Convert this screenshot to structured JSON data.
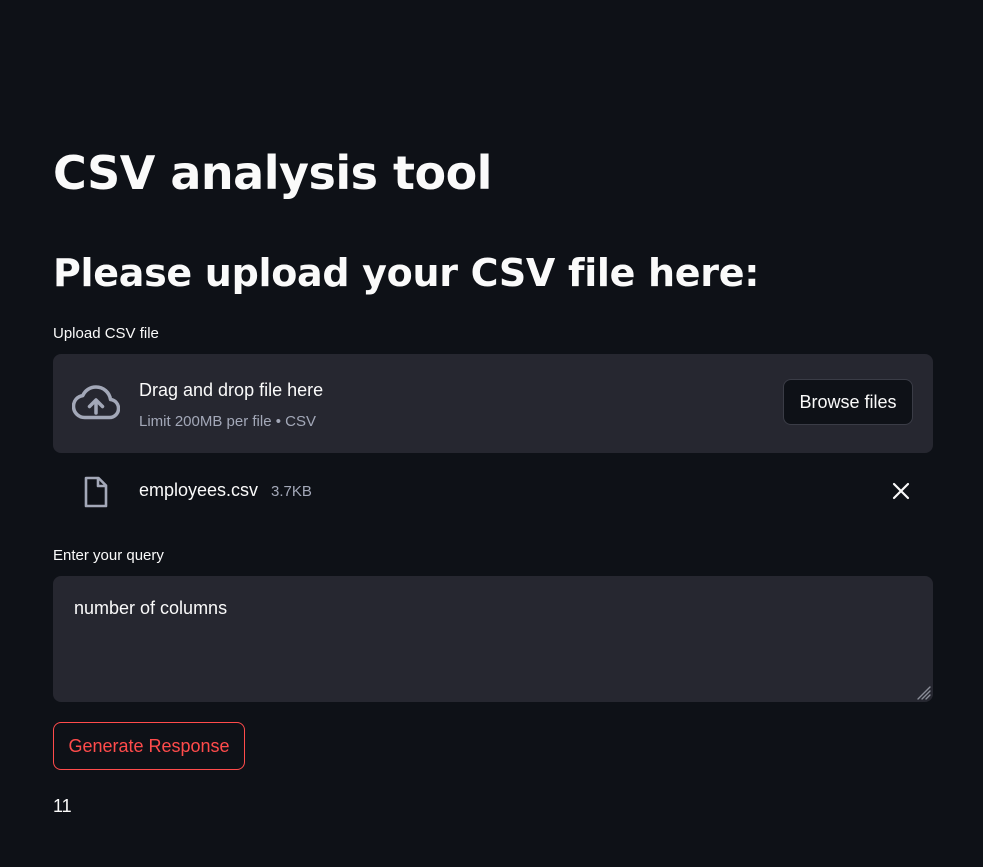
{
  "app": {
    "title": "CSV analysis tool",
    "section_title": "Please upload your CSV file here:"
  },
  "uploader": {
    "label": "Upload CSV file",
    "drop_title": "Drag and drop file here",
    "drop_subtitle": "Limit 200MB per file • CSV",
    "browse_label": "Browse files",
    "icon": "cloud-upload-icon"
  },
  "uploaded_file": {
    "name": "employees.csv",
    "size": "3.7KB",
    "icon": "file-icon",
    "remove_icon": "close-icon"
  },
  "query": {
    "label": "Enter your query",
    "value": "number of columns"
  },
  "generate": {
    "label": "Generate Response"
  },
  "result": {
    "text": "11"
  },
  "colors": {
    "background": "#0e1117",
    "surface": "#262730",
    "text": "#fafafa",
    "muted": "#a3a8b8",
    "accent": "#ff4b4b"
  }
}
